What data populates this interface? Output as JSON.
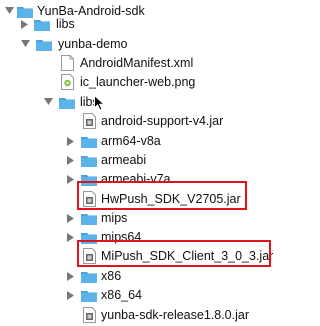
{
  "tree": {
    "rows": [
      {
        "id": "yunba-android-sdk",
        "label": "YunBa-Android-sdk",
        "type": "folder",
        "expanded": true,
        "depth": 0
      },
      {
        "id": "libs-root",
        "label": "libs",
        "type": "folder",
        "expanded": false,
        "depth": 1
      },
      {
        "id": "yunba-demo",
        "label": "yunba-demo",
        "type": "folder",
        "expanded": true,
        "depth": 1
      },
      {
        "id": "android-manifest",
        "label": "AndroidManifest.xml",
        "type": "file",
        "depth": 2
      },
      {
        "id": "ic-launcher-web",
        "label": "ic_launcher-web.png",
        "type": "image",
        "depth": 2
      },
      {
        "id": "libs-demo",
        "label": "libs",
        "type": "folder",
        "expanded": true,
        "depth": 2
      },
      {
        "id": "android-support",
        "label": "android-support-v4.jar",
        "type": "jar",
        "depth": 3
      },
      {
        "id": "arm64-v8a",
        "label": "arm64-v8a",
        "type": "folder",
        "expanded": false,
        "depth": 3
      },
      {
        "id": "armeabi",
        "label": "armeabi",
        "type": "folder",
        "expanded": false,
        "depth": 3
      },
      {
        "id": "armeabi-v7a",
        "label": "armeabi-v7a",
        "type": "folder",
        "expanded": false,
        "depth": 3
      },
      {
        "id": "hwpush-sdk",
        "label": "HwPush_SDK_V2705.jar",
        "type": "jar",
        "depth": 3,
        "highlighted": true
      },
      {
        "id": "mips",
        "label": "mips",
        "type": "folder",
        "expanded": false,
        "depth": 3
      },
      {
        "id": "mips64",
        "label": "mips64",
        "type": "folder",
        "expanded": false,
        "depth": 3
      },
      {
        "id": "mipush-sdk",
        "label": "MiPush_SDK_Client_3_0_3.jar",
        "type": "jar",
        "depth": 3,
        "highlighted": true
      },
      {
        "id": "x86",
        "label": "x86",
        "type": "folder",
        "expanded": false,
        "depth": 3
      },
      {
        "id": "x86-64",
        "label": "x86_64",
        "type": "folder",
        "expanded": false,
        "depth": 3
      },
      {
        "id": "yunba-sdk-release",
        "label": "yunba-sdk-release1.8.0.jar",
        "type": "jar",
        "depth": 3
      }
    ]
  },
  "colors": {
    "folder": "#5ab4ea",
    "folder_tab": "#4aa3dc",
    "highlight": "#e0131a",
    "triangle": "#777777"
  }
}
